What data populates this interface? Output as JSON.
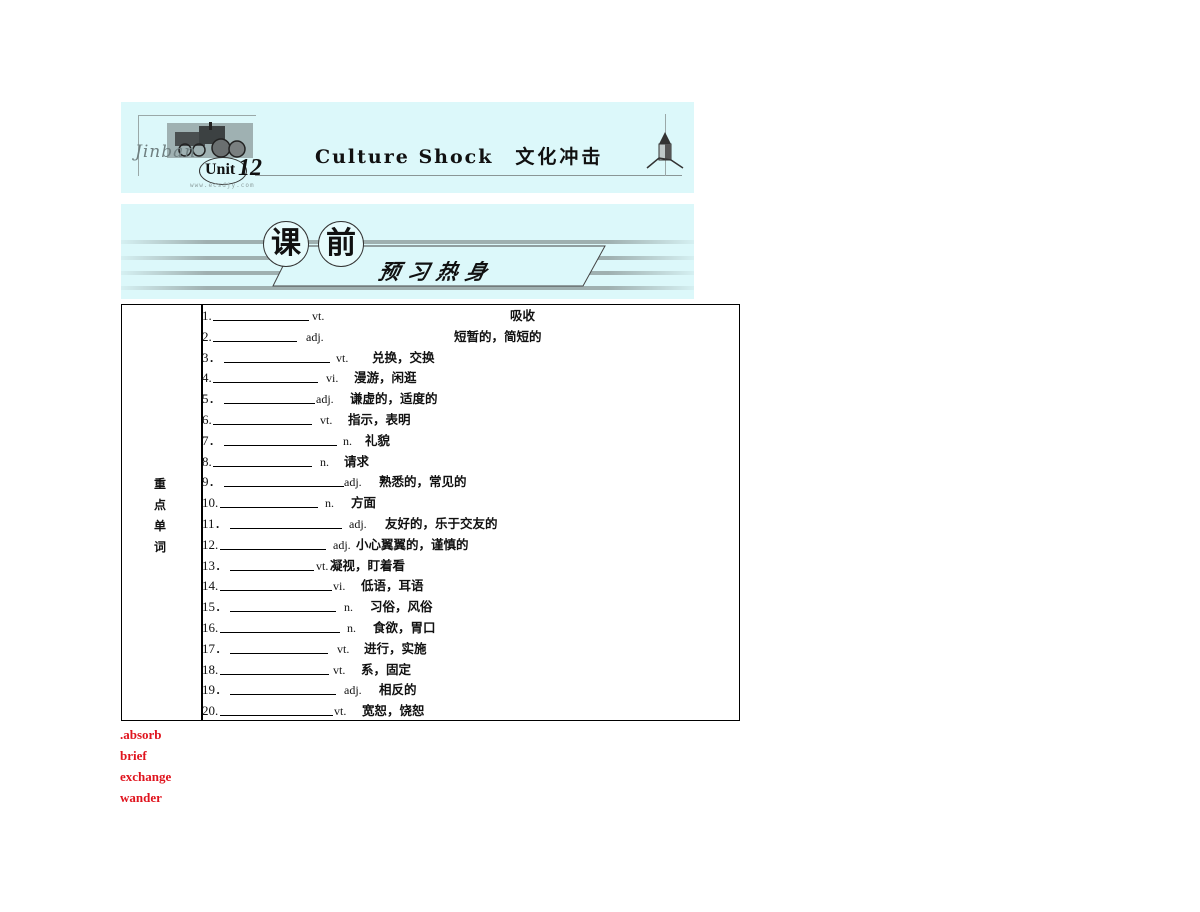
{
  "banner_unit": {
    "brand_text": "Jinban",
    "unit_label": "Unit",
    "unit_number": "12",
    "website": "www.ecsdjy.com",
    "title_en": "Culture Shock",
    "title_cn": "文化冲击"
  },
  "banner_section": {
    "circle_1": "课",
    "circle_2": "前",
    "subtitle": "预习热身"
  },
  "vocab_table": {
    "category_label": "重点单词",
    "category_chars": [
      "重",
      "点",
      "单",
      "词"
    ],
    "rows": [
      {
        "num": "1.",
        "pos": "vt.",
        "meaning": "吸收"
      },
      {
        "num": "2.",
        "pos": "adj.",
        "meaning": "短暂的，简短的"
      },
      {
        "num": "3．",
        "pos": "vt.",
        "meaning": "兑换，交换"
      },
      {
        "num": "4.",
        "pos": "vi.",
        "meaning": "漫游，闲逛"
      },
      {
        "num": "5．",
        "pos": "adj.",
        "meaning": "谦虚的，适度的"
      },
      {
        "num": "6.",
        "pos": "vt.",
        "meaning": "指示，表明"
      },
      {
        "num": "7．",
        "pos": "n.",
        "meaning": "礼貌"
      },
      {
        "num": "8.",
        "pos": "n.",
        "meaning": "请求"
      },
      {
        "num": "9．",
        "pos": "adj.",
        "meaning": "熟悉的，常见的"
      },
      {
        "num": "10.",
        "pos": "n.",
        "meaning": "方面"
      },
      {
        "num": "11．",
        "pos": "adj.",
        "meaning": "友好的，乐于交友的"
      },
      {
        "num": "12.",
        "pos": "adj.",
        "meaning": "小心翼翼的，谨慎的"
      },
      {
        "num": "13．",
        "pos": "vt.",
        "meaning": "凝视，盯着看"
      },
      {
        "num": "14.",
        "pos": "vi.",
        "meaning": "低语，耳语"
      },
      {
        "num": "15．",
        "pos": "n.",
        "meaning": "习俗，风俗"
      },
      {
        "num": "16.",
        "pos": "n.",
        "meaning": "食欲，胃口"
      },
      {
        "num": "17．",
        "pos": "vt.",
        "meaning": "进行，实施"
      },
      {
        "num": "18.",
        "pos": "vt.",
        "meaning": "系，固定"
      },
      {
        "num": "19．",
        "pos": "adj.",
        "meaning": "相反的"
      },
      {
        "num": "20.",
        "pos": "vt.",
        "meaning": "宽恕，饶恕"
      }
    ]
  },
  "answers": [
    ".absorb",
    "brief",
    "exchange",
    "wander"
  ],
  "colors": {
    "banner_bg": "#dcf8fa",
    "answer_red": "#e0141e"
  }
}
